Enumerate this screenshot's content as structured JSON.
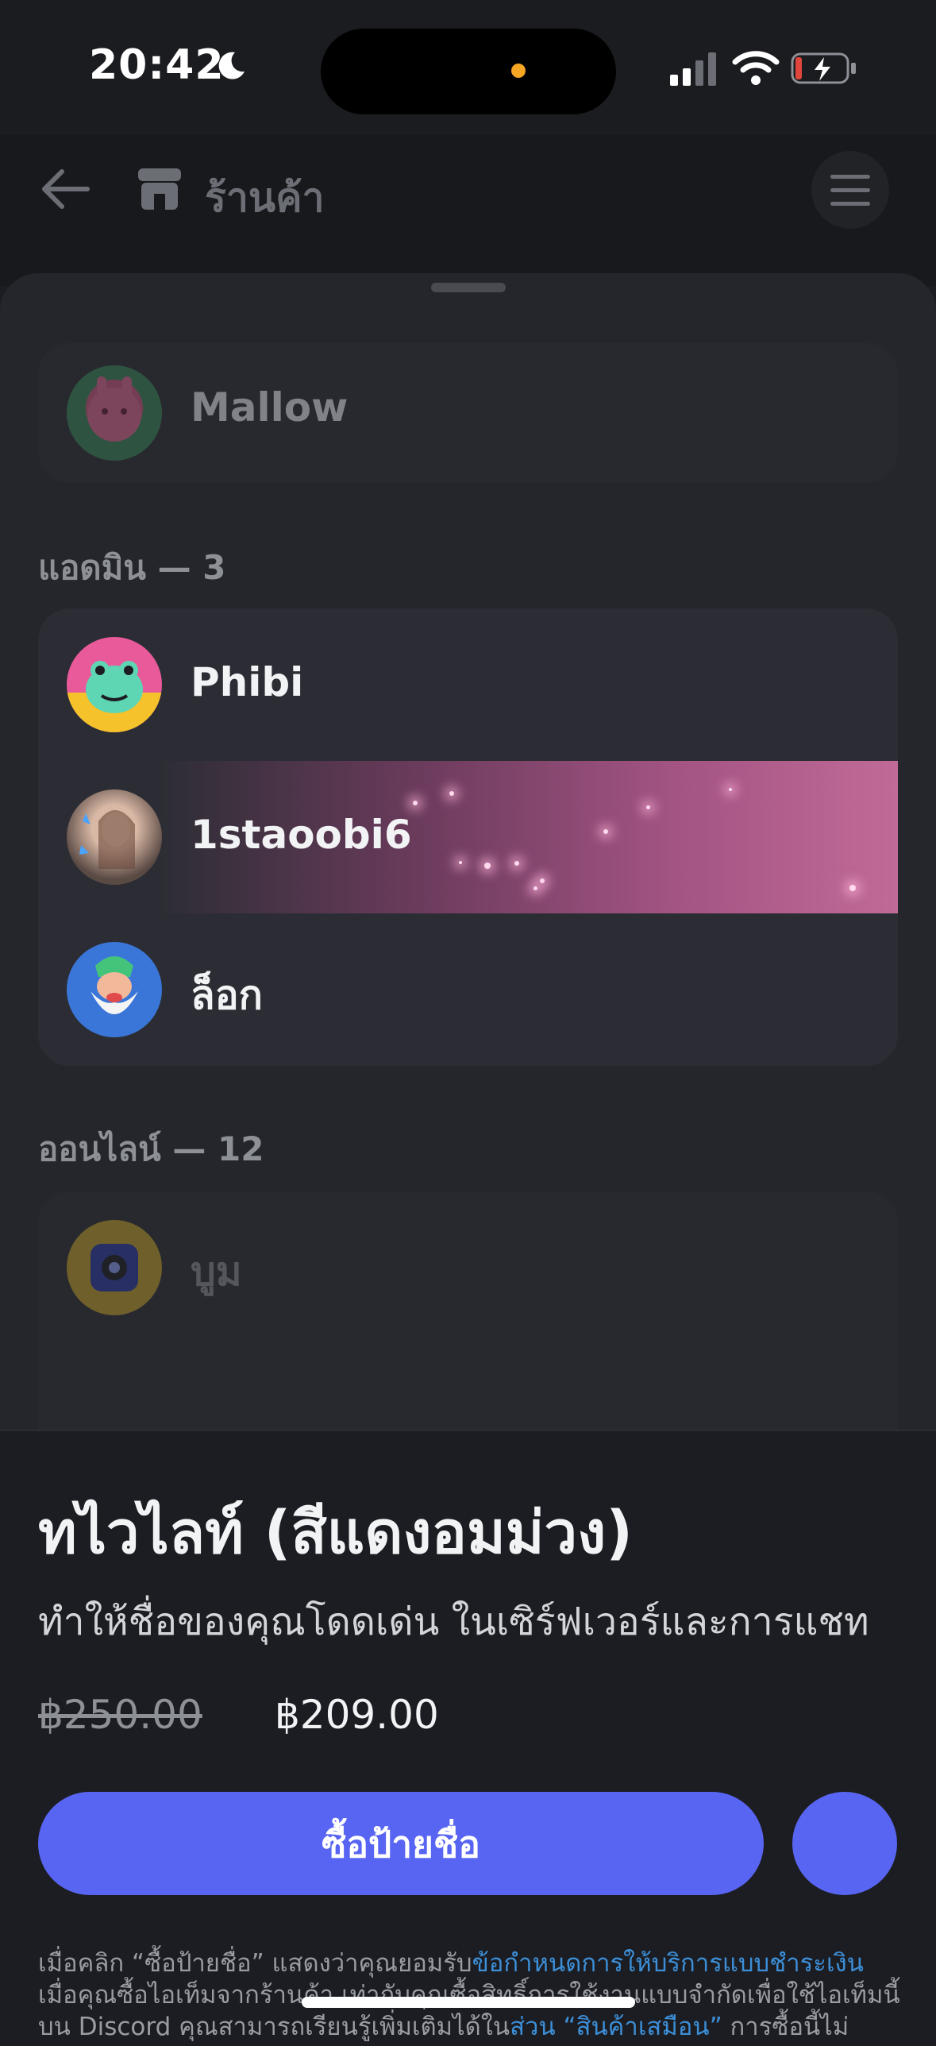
{
  "status_bar": {
    "time": "20:42"
  },
  "header": {
    "title": "ร้านค้า"
  },
  "preview": {
    "top_member": "Mallow",
    "admins_heading": "แอดมิน — 3",
    "admins": [
      "Phibi",
      "1staoobi6",
      "ล็อก"
    ],
    "online_heading": "ออนไลน์ — 12",
    "online_first": "บูม"
  },
  "product": {
    "title": "ทไวไลท์ (สีแดงอมม่วง)",
    "description": "ทำให้ชื่อของคุณโดดเด่น ในเซิร์ฟเวอร์และการแชท",
    "old_price": "฿250.00",
    "new_price": "฿209.00",
    "buy_label": "ซื้อป้ายชื่อ"
  },
  "fineprint": {
    "line1_text": "เมื่อคลิก “ซื้อป้ายชื่อ” แสดงว่าคุณยอมรับ",
    "line1_link": "ข้อกำหนดการให้บริการแบบชำระเงิน",
    "line2": "เมื่อคุณซื้อไอเท็มจากร้านค้า เท่ากับคุณซื้อสิทธิ์การใช้งานแบบจำกัดเพื่อใช้ไอเท็มนี้",
    "line3_text": "บน Discord คุณสามารถเรียนรู้เพิ่มเติมได้ใน",
    "line3_link": "ส่วน “สินค้าเสมือน”",
    "line3_tail": " การซื้อนี้ไม่"
  },
  "colors": {
    "accent": "#5865f2",
    "link": "#3c8fd8",
    "nameplate": "#c16a97"
  }
}
